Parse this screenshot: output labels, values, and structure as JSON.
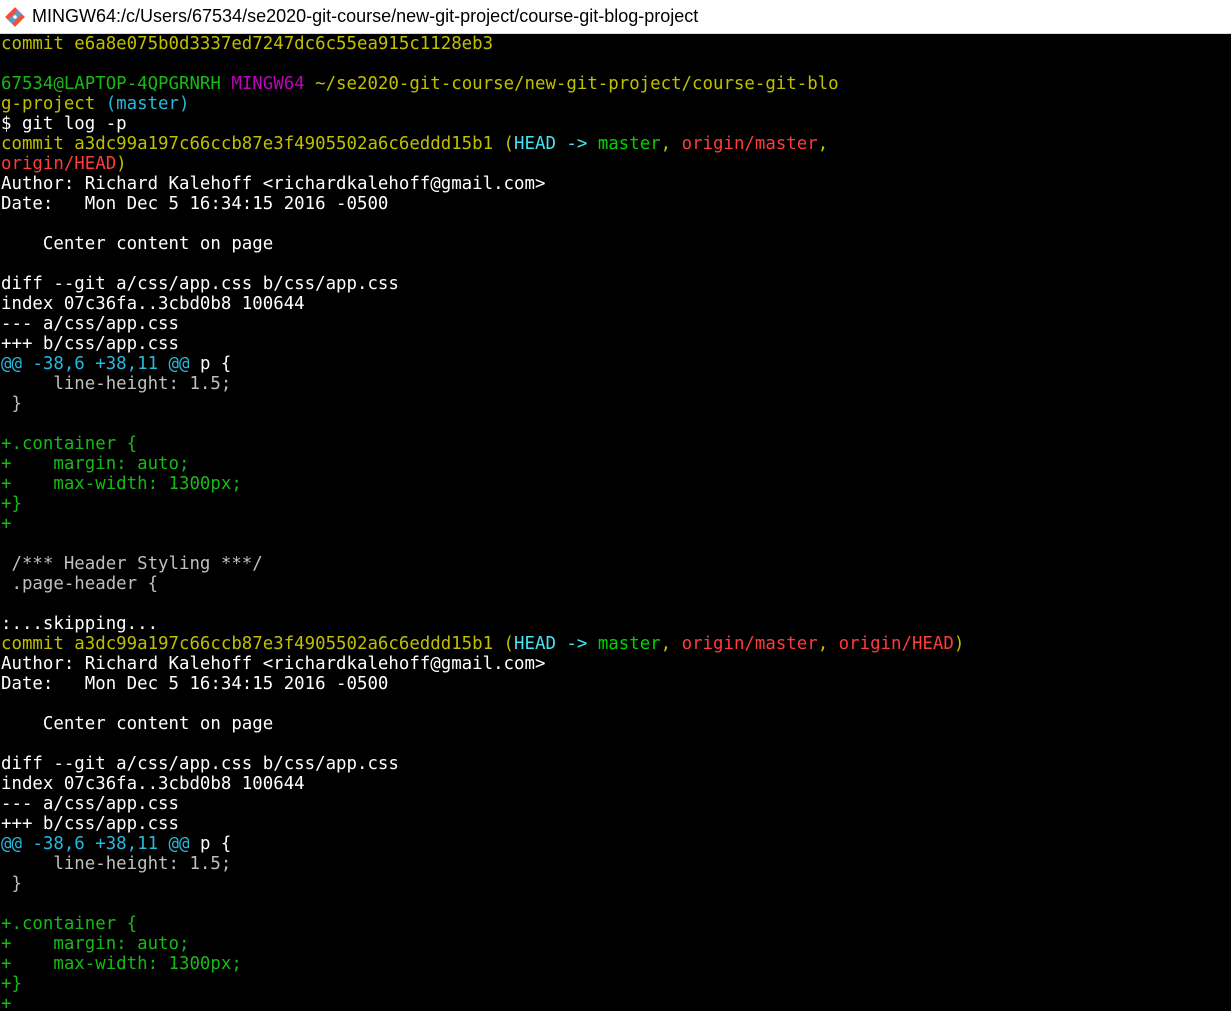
{
  "window": {
    "title": "MINGW64:/c/Users/67534/se2020-git-course/new-git-project/course-git-blog-project",
    "icon": "git-bash-icon"
  },
  "colors": {
    "background": "#000000",
    "commit_hash": "#c0c000",
    "head_ref": "#45e5f2",
    "branch": "#00d200",
    "remote_branch": "#ff3b3b",
    "added_line": "#17b917",
    "hunk_header": "#29b8db",
    "prompt_user": "#17b917",
    "prompt_shell": "#c000c0"
  },
  "terminal": {
    "lines": [
      {
        "segments": [
          {
            "t": "commit e6a8e075b0d3337ed7247dc6c55ea915c1128eb3",
            "c": "y"
          }
        ]
      },
      {
        "segments": []
      },
      {
        "segments": [
          {
            "t": "67534@LAPTOP-4QPGRNRH ",
            "c": "grn"
          },
          {
            "t": "MINGW64 ",
            "c": "mg"
          },
          {
            "t": "~/se2020-git-course/new-git-project/course-git-blo",
            "c": "y"
          }
        ]
      },
      {
        "segments": [
          {
            "t": "g-project",
            "c": "y"
          },
          {
            "t": " (master)",
            "c": "cy"
          }
        ]
      },
      {
        "segments": [
          {
            "t": "$ git log -p",
            "c": "w"
          }
        ]
      },
      {
        "segments": [
          {
            "t": "commit a3dc99a197c66ccb87e3f4905502a6c6eddd15b1 (",
            "c": "y"
          },
          {
            "t": "HEAD -> ",
            "c": "bcy"
          },
          {
            "t": "master",
            "c": "bgrn"
          },
          {
            "t": ", ",
            "c": "y"
          },
          {
            "t": "origin/master",
            "c": "rd"
          },
          {
            "t": ",",
            "c": "y"
          }
        ]
      },
      {
        "segments": [
          {
            "t": "origin/HEAD",
            "c": "rd"
          },
          {
            "t": ")",
            "c": "y"
          }
        ]
      },
      {
        "segments": [
          {
            "t": "Author: Richard Kalehoff <richardkalehoff@gmail.com>",
            "c": "w"
          }
        ]
      },
      {
        "segments": [
          {
            "t": "Date:   Mon Dec 5 16:34:15 2016 -0500",
            "c": "w"
          }
        ]
      },
      {
        "segments": []
      },
      {
        "segments": [
          {
            "t": "    Center content on page",
            "c": "w"
          }
        ]
      },
      {
        "segments": []
      },
      {
        "segments": [
          {
            "t": "diff --git a/css/app.css b/css/app.css",
            "c": "w"
          }
        ]
      },
      {
        "segments": [
          {
            "t": "index 07c36fa..3cbd0b8 100644",
            "c": "w"
          }
        ]
      },
      {
        "segments": [
          {
            "t": "--- a/css/app.css",
            "c": "w"
          }
        ]
      },
      {
        "segments": [
          {
            "t": "+++ b/css/app.css",
            "c": "w"
          }
        ]
      },
      {
        "segments": [
          {
            "t": "@@ -38,6 +38,11 @@",
            "c": "cy"
          },
          {
            "t": " p {",
            "c": "w"
          }
        ]
      },
      {
        "segments": [
          {
            "t": "     line-height: 1.5;",
            "c": "g"
          }
        ]
      },
      {
        "segments": [
          {
            "t": " }",
            "c": "g"
          }
        ]
      },
      {
        "segments": []
      },
      {
        "segments": [
          {
            "t": "+.container {",
            "c": "grn"
          }
        ]
      },
      {
        "segments": [
          {
            "t": "+    margin: auto;",
            "c": "grn"
          }
        ]
      },
      {
        "segments": [
          {
            "t": "+    max-width: 1300px;",
            "c": "grn"
          }
        ]
      },
      {
        "segments": [
          {
            "t": "+}",
            "c": "grn"
          }
        ]
      },
      {
        "segments": [
          {
            "t": "+",
            "c": "grn"
          }
        ]
      },
      {
        "segments": []
      },
      {
        "segments": [
          {
            "t": " /*** Header Styling ***/",
            "c": "g"
          }
        ]
      },
      {
        "segments": [
          {
            "t": " .page-header {",
            "c": "g"
          }
        ]
      },
      {
        "segments": []
      },
      {
        "segments": [
          {
            "t": ":...skipping...",
            "c": "w"
          }
        ]
      },
      {
        "segments": [
          {
            "t": "commit a3dc99a197c66ccb87e3f4905502a6c6eddd15b1 (",
            "c": "y"
          },
          {
            "t": "HEAD -> ",
            "c": "bcy"
          },
          {
            "t": "master",
            "c": "bgrn"
          },
          {
            "t": ", ",
            "c": "y"
          },
          {
            "t": "origin/master",
            "c": "rd"
          },
          {
            "t": ", ",
            "c": "y"
          },
          {
            "t": "origin/HEAD",
            "c": "rd"
          },
          {
            "t": ")",
            "c": "y"
          }
        ]
      },
      {
        "segments": [
          {
            "t": "Author: Richard Kalehoff <richardkalehoff@gmail.com>",
            "c": "w"
          }
        ]
      },
      {
        "segments": [
          {
            "t": "Date:   Mon Dec 5 16:34:15 2016 -0500",
            "c": "w"
          }
        ]
      },
      {
        "segments": []
      },
      {
        "segments": [
          {
            "t": "    Center content on page",
            "c": "w"
          }
        ]
      },
      {
        "segments": []
      },
      {
        "segments": [
          {
            "t": "diff --git a/css/app.css b/css/app.css",
            "c": "w"
          }
        ]
      },
      {
        "segments": [
          {
            "t": "index 07c36fa..3cbd0b8 100644",
            "c": "w"
          }
        ]
      },
      {
        "segments": [
          {
            "t": "--- a/css/app.css",
            "c": "w"
          }
        ]
      },
      {
        "segments": [
          {
            "t": "+++ b/css/app.css",
            "c": "w"
          }
        ]
      },
      {
        "segments": [
          {
            "t": "@@ -38,6 +38,11 @@",
            "c": "cy"
          },
          {
            "t": " p {",
            "c": "w"
          }
        ]
      },
      {
        "segments": [
          {
            "t": "     line-height: 1.5;",
            "c": "g"
          }
        ]
      },
      {
        "segments": [
          {
            "t": " }",
            "c": "g"
          }
        ]
      },
      {
        "segments": []
      },
      {
        "segments": [
          {
            "t": "+.container {",
            "c": "grn"
          }
        ]
      },
      {
        "segments": [
          {
            "t": "+    margin: auto;",
            "c": "grn"
          }
        ]
      },
      {
        "segments": [
          {
            "t": "+    max-width: 1300px;",
            "c": "grn"
          }
        ]
      },
      {
        "segments": [
          {
            "t": "+}",
            "c": "grn"
          }
        ]
      },
      {
        "segments": [
          {
            "t": "+",
            "c": "grn"
          }
        ]
      }
    ]
  }
}
